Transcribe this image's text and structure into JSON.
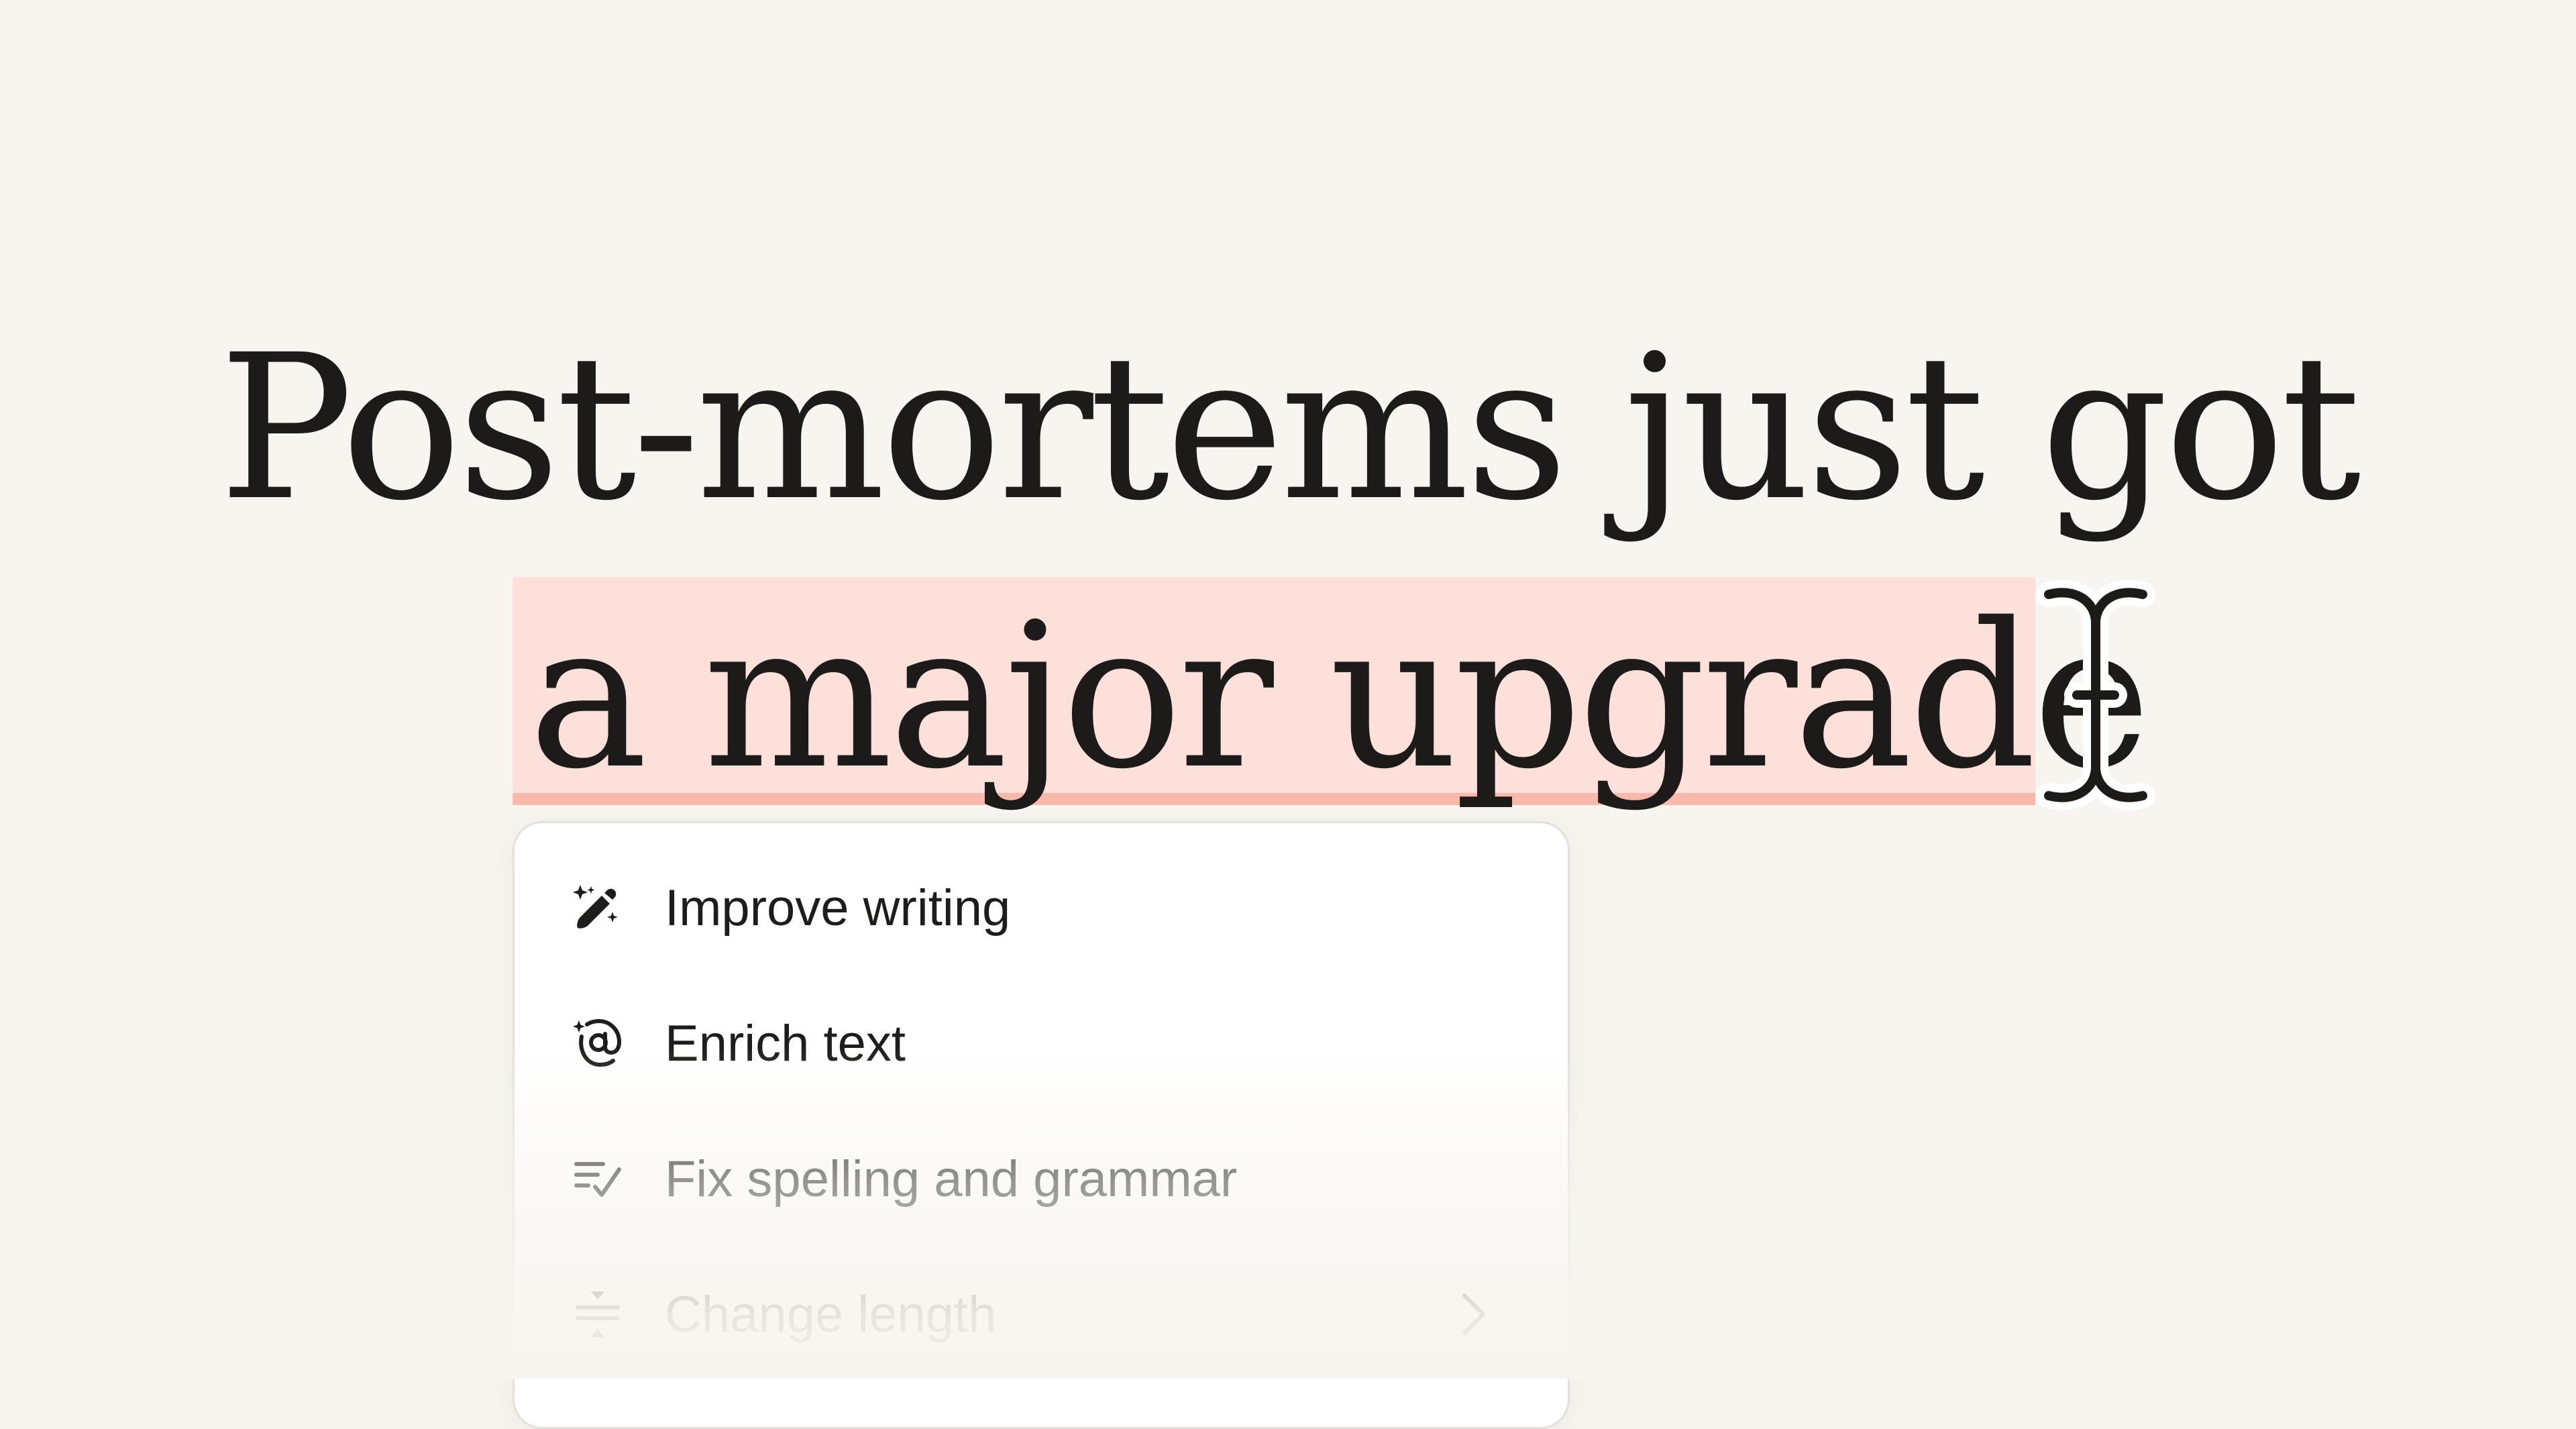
{
  "headline": {
    "line1": "Post-mortems just got",
    "line2": "a major upgrade"
  },
  "menu": {
    "items": [
      {
        "label": "Improve writing",
        "icon": "magic-pen-icon"
      },
      {
        "label": "Enrich text",
        "icon": "sparkle-at-icon"
      },
      {
        "label": "Fix spelling and grammar",
        "icon": "list-check-icon"
      },
      {
        "label": "Change length",
        "icon": "adjust-length-icon",
        "has_submenu": true
      }
    ]
  },
  "colors": {
    "background": "#f8f5f0",
    "highlight": "#fde0da",
    "highlight_underline": "#f8b8aa",
    "text": "#1c1b1a"
  }
}
